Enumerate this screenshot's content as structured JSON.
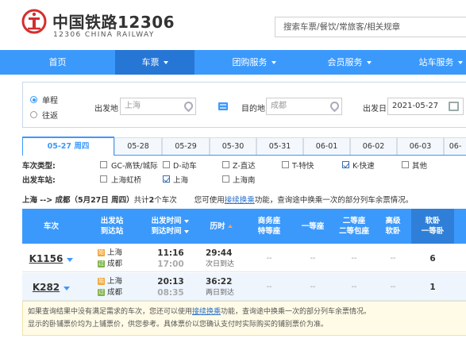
{
  "header": {
    "logo_cn": "中国铁路12306",
    "logo_en": "12306 CHINA RAILWAY",
    "search_placeholder": "搜索车票/餐饮/常旅客/相关规章",
    "brand_color": "#d42e2e"
  },
  "nav": {
    "items": [
      {
        "label": "首页",
        "dropdown": false,
        "active": false
      },
      {
        "label": "车票",
        "dropdown": true,
        "active": true
      },
      {
        "label": "团购服务",
        "dropdown": true,
        "active": false
      },
      {
        "label": "会员服务",
        "dropdown": true,
        "active": false
      },
      {
        "label": "站车服务",
        "dropdown": true,
        "active": false
      }
    ],
    "color": "#3b99fc"
  },
  "query": {
    "trip_oneway": "单程",
    "trip_round": "往返",
    "from_label": "出发地",
    "from_value": "上海",
    "to_label": "目的地",
    "to_value": "成都",
    "date_label": "出发日",
    "date_value": "2021-05-27"
  },
  "date_tabs": [
    "05-27 周四",
    "05-28",
    "05-29",
    "05-30",
    "05-31",
    "06-01",
    "06-02",
    "06-03",
    "06-"
  ],
  "filters": {
    "type_label": "车次类型:",
    "types": [
      {
        "label": "GC-高铁/城际",
        "checked": false
      },
      {
        "label": "D-动车",
        "checked": false
      },
      {
        "label": "Z-直达",
        "checked": false
      },
      {
        "label": "T-特快",
        "checked": false
      },
      {
        "label": "K-快速",
        "checked": true
      },
      {
        "label": "其他",
        "checked": false
      }
    ],
    "station_label": "出发车站:",
    "stations": [
      {
        "label": "上海虹桥",
        "checked": false
      },
      {
        "label": "上海",
        "checked": true
      },
      {
        "label": "上海南",
        "checked": false
      }
    ]
  },
  "summary": {
    "route": "上海 --> 成都（5月27日 周四）",
    "count_prefix": "共计",
    "count": "2",
    "count_suffix": "个车次",
    "hint_prefix": "您可使用",
    "hint_link": "接续换乘",
    "hint_suffix": "功能，查询途中换乘一次的部分列车余票情况。"
  },
  "table": {
    "headers": {
      "train": "车次",
      "station_1": "出发站",
      "station_2": "到达站",
      "time_1": "出发时间",
      "time_2": "到达时间",
      "duration": "历时",
      "business_1": "商务座",
      "business_2": "特等座",
      "first": "一等座",
      "second_1": "二等座",
      "second_2": "二等包座",
      "deluxe_1": "高级",
      "deluxe_2": "软卧",
      "soft_1": "软卧",
      "soft_2": "一等卧"
    },
    "rows": [
      {
        "train": "K1156",
        "from_badge": "始",
        "from": "上海",
        "to_badge": "过",
        "to": "成都",
        "depart": "11:16",
        "arrive": "17:00",
        "duration": "29:44",
        "duration_note": "次日到达",
        "business": "--",
        "first": "--",
        "second": "--",
        "deluxe": "--",
        "soft": "6"
      },
      {
        "train": "K282",
        "from_badge": "始",
        "from": "上海",
        "to_badge": "过",
        "to": "成都",
        "depart": "20:13",
        "arrive": "08:35",
        "duration": "36:22",
        "duration_note": "两日到达",
        "business": "--",
        "first": "--",
        "second": "--",
        "deluxe": "--",
        "soft": "1"
      }
    ]
  },
  "note": {
    "line1_prefix": "如果查询结果中没有满足需求的车次，您还可以使用",
    "line1_link": "接续换乘",
    "line1_suffix": "功能，查询途中换乘一次的部分列车余票情况。",
    "line2": "显示的卧铺票价均为上铺票价，供您参考。具体票价以您确认支付时实际购买的铺别票价为准。"
  }
}
